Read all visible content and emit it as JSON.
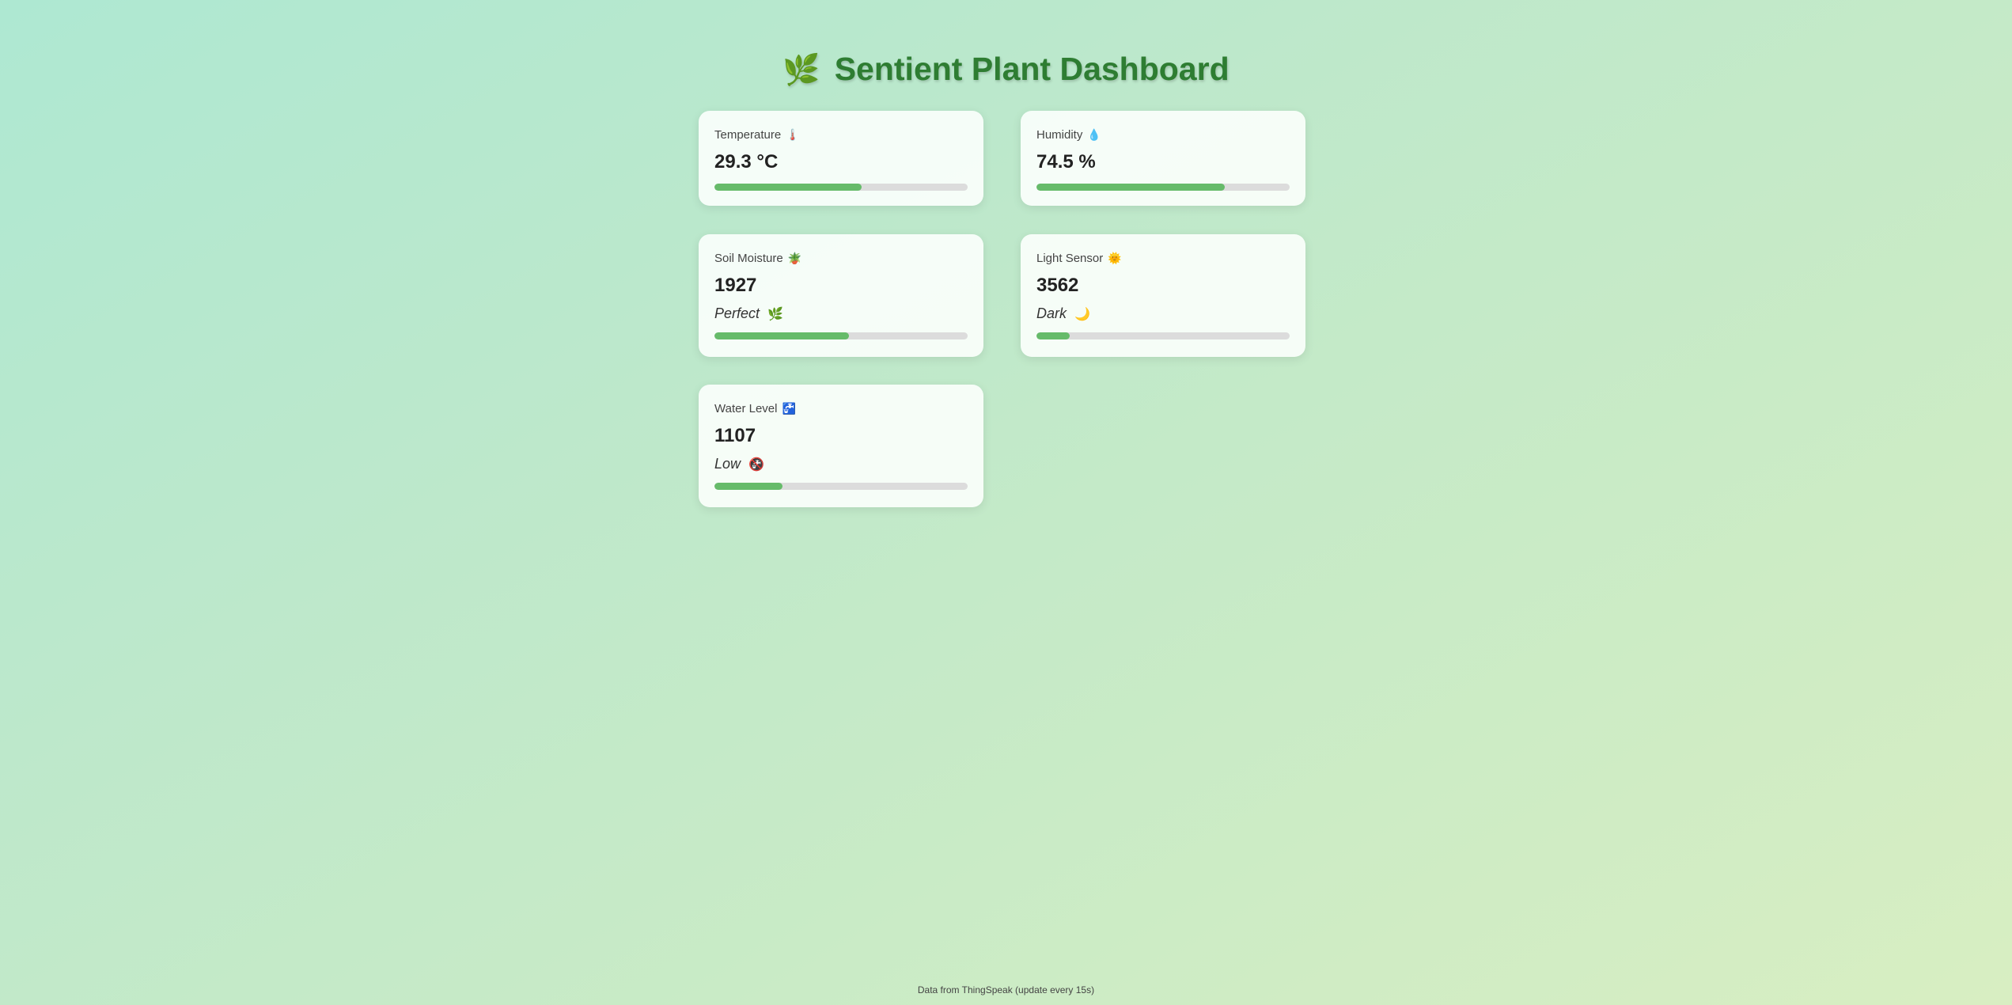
{
  "header": {
    "icon": "leaf-icon",
    "icon_glyph": "🌿",
    "title": "Sentient Plant Dashboard"
  },
  "cards": {
    "temperature": {
      "label": "Temperature",
      "icon": "thermometer-icon",
      "icon_glyph": "🌡️",
      "value": "29.3 °C",
      "progress": 0.58
    },
    "humidity": {
      "label": "Humidity",
      "icon": "droplet-icon",
      "icon_glyph": "💧",
      "value": "74.5 %",
      "progress": 0.745
    },
    "soil": {
      "label": "Soil Moisture",
      "icon": "potted-plant-icon",
      "icon_glyph": "🪴",
      "value": "1927",
      "status": "Perfect",
      "status_icon": "herb-icon",
      "status_glyph": "🌿",
      "progress": 0.53
    },
    "light": {
      "label": "Light Sensor",
      "icon": "sun-icon",
      "icon_glyph": "🌞",
      "value": "3562",
      "status": "Dark",
      "status_icon": "crescent-moon-icon",
      "status_glyph": "🌙",
      "progress": 0.13
    },
    "water": {
      "label": "Water Level",
      "icon": "faucet-icon",
      "icon_glyph": "🚰",
      "value": "1107",
      "status": "Low",
      "status_icon": "no-water-icon",
      "status_glyph": "🚱",
      "progress": 0.27
    }
  },
  "footer": {
    "text": "Data from ThingSpeak (update every 15s)"
  },
  "colors": {
    "accent": "#2e7d32",
    "bar_fill": "#66bb6a",
    "bar_track": "#dcdcdc"
  }
}
